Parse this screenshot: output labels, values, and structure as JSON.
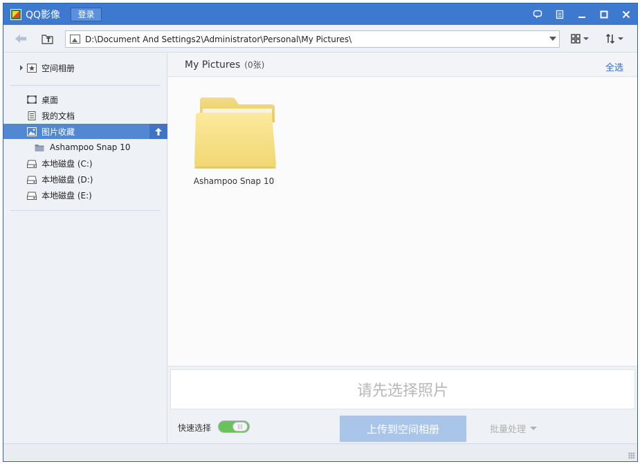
{
  "titlebar": {
    "title": "QQ影像",
    "login_label": "登录",
    "icons": [
      "feedback-icon",
      "skin-icon",
      "minimize-icon",
      "maximize-icon",
      "close-icon"
    ]
  },
  "toolbar": {
    "address_path": "D:\\Document And Settings2\\Administrator\\Personal\\My Pictures\\",
    "icons": [
      "back-arrow-icon",
      "parent-folder-icon",
      "picture-icon",
      "dropdown-icon",
      "view-grid-icon",
      "sort-icon"
    ]
  },
  "sidebar": {
    "cloud": {
      "label": "空间相册",
      "icon": "cloud-album-icon"
    },
    "items": [
      {
        "label": "桌面",
        "icon": "desktop-icon"
      },
      {
        "label": "我的文档",
        "icon": "documents-icon"
      },
      {
        "label": "图片收藏",
        "icon": "pictures-icon",
        "selected": true
      },
      {
        "label": "Ashampoo Snap 10",
        "icon": "folder-icon"
      },
      {
        "label": "本地磁盘 (C:)",
        "icon": "drive-icon"
      },
      {
        "label": "本地磁盘 (D:)",
        "icon": "drive-icon"
      },
      {
        "label": "本地磁盘 (E:)",
        "icon": "drive-icon"
      }
    ]
  },
  "main": {
    "folder_title": "My Pictures",
    "count_label": "(0张)",
    "select_all": "全选",
    "items": [
      {
        "label": "Ashampoo Snap 10",
        "icon": "folder-icon"
      }
    ]
  },
  "bottom": {
    "hint": "请先选择照片",
    "quick_select_label": "快速选择",
    "quick_select_on": true,
    "upload_label": "上传到空间相册",
    "batch_label": "批量处理"
  },
  "colors": {
    "titlebar": "#3d79cf",
    "selection": "#5287d2",
    "accent_link": "#2e6ec8",
    "upload_disabled": "#a9c6ea",
    "toggle_on": "#69c25a"
  }
}
